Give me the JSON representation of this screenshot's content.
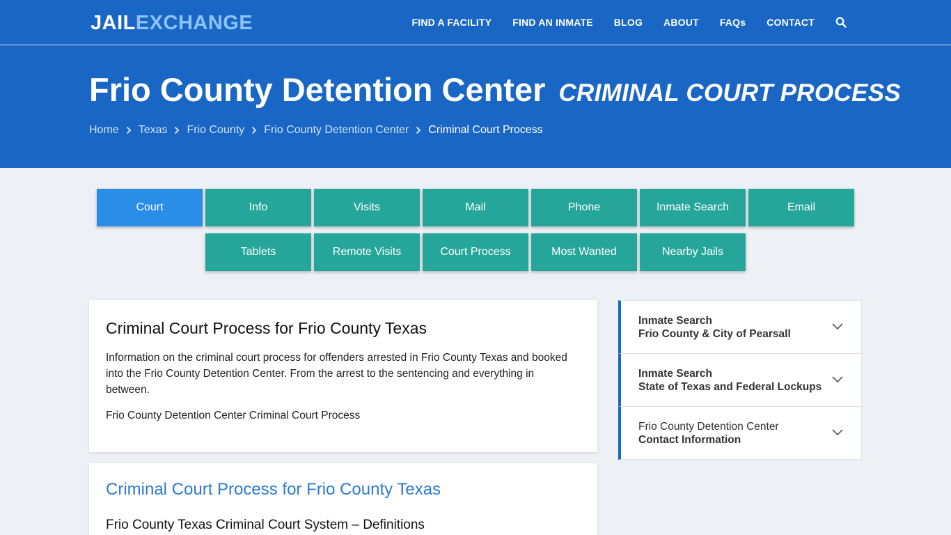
{
  "logo": {
    "part1": "JAIL",
    "part2": "EXCHANGE"
  },
  "nav": {
    "items": [
      "FIND A FACILITY",
      "FIND AN INMATE",
      "BLOG",
      "ABOUT",
      "FAQs",
      "CONTACT"
    ]
  },
  "hero": {
    "title": "Frio County Detention Center",
    "subtitle": "CRIMINAL COURT PROCESS"
  },
  "breadcrumb": [
    "Home",
    "Texas",
    "Frio County",
    "Frio County Detention Center",
    "Criminal Court Process"
  ],
  "tabs": {
    "row1": [
      "Court",
      "Info",
      "Visits",
      "Mail",
      "Phone",
      "Inmate Search",
      "Email"
    ],
    "row2": [
      "Tablets",
      "Remote Visits",
      "Court Process",
      "Most Wanted",
      "Nearby Jails"
    ],
    "active": "Court"
  },
  "card1": {
    "title": "Criminal Court Process for Frio County Texas",
    "intro": "Information on the criminal court process for offenders arrested in Frio County Texas and booked into the Frio County Detention Center. From the arrest to the sentencing and everything in between.",
    "note": "Frio County Detention Center Criminal Court Process"
  },
  "card2": {
    "title": "Criminal Court Process for Frio County Texas",
    "subtitle": "Frio County Texas Criminal Court System – Definitions"
  },
  "sidebar": {
    "items": [
      {
        "line1": "Inmate Search",
        "line2": "Frio County & City of Pearsall"
      },
      {
        "line1": "Inmate Search",
        "line2": "State of Texas and Federal Lockups"
      },
      {
        "line1": "Frio County Detention Center",
        "line2": "Contact Information"
      }
    ]
  },
  "colors": {
    "brand": "#1a66c4",
    "tab": "#26a69a",
    "tab_active": "#2a8de6",
    "link": "#2a7bd4"
  }
}
